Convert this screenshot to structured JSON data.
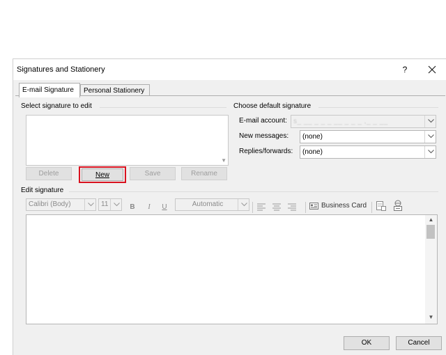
{
  "window": {
    "title": "Signatures and Stationery",
    "help_glyph": "?",
    "close_glyph": "✕"
  },
  "tabs": [
    {
      "label": "E-mail Signature",
      "active": true
    },
    {
      "label": "Personal Stationery",
      "active": false
    }
  ],
  "select_group": {
    "label": "Select signature to edit",
    "buttons": {
      "delete": "Delete",
      "new": "New",
      "save": "Save",
      "rename": "Rename"
    }
  },
  "default_group": {
    "label": "Choose default signature",
    "email_account_label": "E-mail account:",
    "email_account_value": "s_ __ _ _ _ __ _ _ _ ,_ _ __",
    "new_messages_label": "New messages:",
    "new_messages_value": "(none)",
    "replies_label": "Replies/forwards:",
    "replies_value": "(none)"
  },
  "edit_group": {
    "label": "Edit signature",
    "font_value": "Calibri (Body)",
    "size_value": "11",
    "bold": "B",
    "italic": "I",
    "underline": "U",
    "color_value": "Automatic",
    "business_card": "Business Card"
  },
  "footer": {
    "ok": "OK",
    "cancel": "Cancel"
  },
  "colors": {
    "highlight": "#d9121f",
    "dialog_bg": "#f0f0f0"
  }
}
